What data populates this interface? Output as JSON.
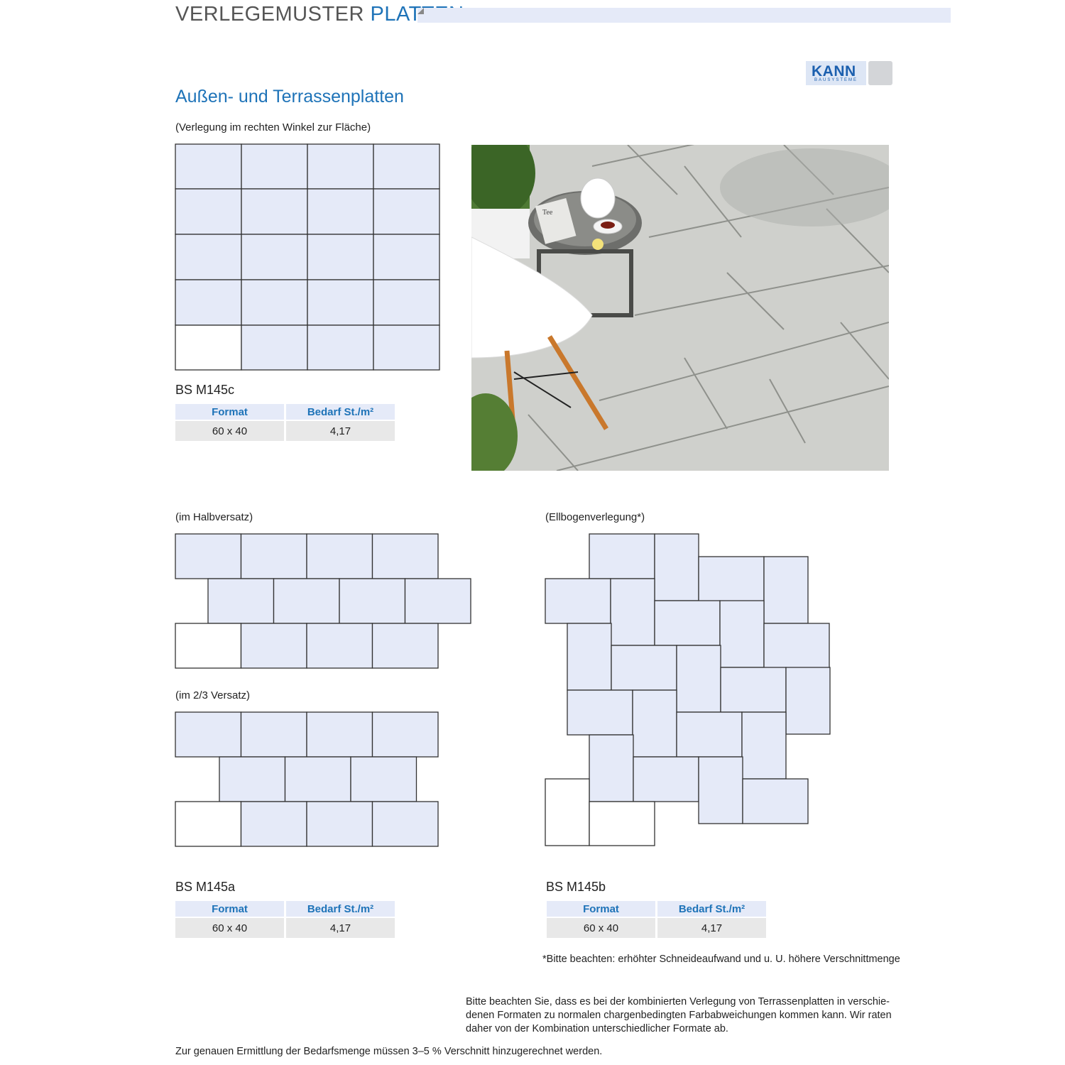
{
  "header": {
    "title_main": "VERLEGEMUSTER",
    "title_accent": "PLATTEN"
  },
  "logo": {
    "word": "KANN",
    "sub": "BAUSYSTEME"
  },
  "colors": {
    "accent_blue": "#1e73b8",
    "tile_fill": "#e5eaf8",
    "header_bar": "#e5eaf8",
    "table_header_bg": "#e5eaf8",
    "table_cell_bg": "#e8e8e8"
  },
  "section": {
    "title": "Außen- und Terrassenplatten"
  },
  "patterns": {
    "rechter_winkel": {
      "caption": "(Verlegung im rechten Winkel zur Fläche)",
      "model": "BS M145c",
      "table": {
        "col1": "Format",
        "col2": "Bedarf St./m²",
        "format": "60 x 40",
        "bedarf": "4,17"
      }
    },
    "halbversatz": {
      "caption": "(im Halbversatz)"
    },
    "zweidrittel": {
      "caption": "(im 2/3 Versatz)",
      "model": "BS M145a",
      "table": {
        "col1": "Format",
        "col2": "Bedarf St./m²",
        "format": "60 x 40",
        "bedarf": "4,17"
      }
    },
    "ellbogen": {
      "caption": "(Ellbogenverlegung*)",
      "model": "BS M145b",
      "table": {
        "col1": "Format",
        "col2": "Bedarf St./m²",
        "format": "60 x 40",
        "bedarf": "4,17"
      }
    }
  },
  "photo": {
    "label": "Tee"
  },
  "notes": {
    "footnote": "*Bitte beachten: erhöhter Schneideaufwand und u. U. höhere Verschnittmenge",
    "combination_line1": "Bitte beachten Sie, dass es bei der kombinierten Verlegung von Terrassenplatten in verschie-",
    "combination_line2": "denen Formaten zu normalen chargenbedingten Farbabweichungen kommen kann. Wir raten",
    "combination_line3": "daher von der Kombination unterschiedlicher Formate ab.",
    "bottom": "Zur genauen Ermittlung der Bedarfsmenge müssen 3–5 % Verschnitt hinzugerechnet werden."
  }
}
